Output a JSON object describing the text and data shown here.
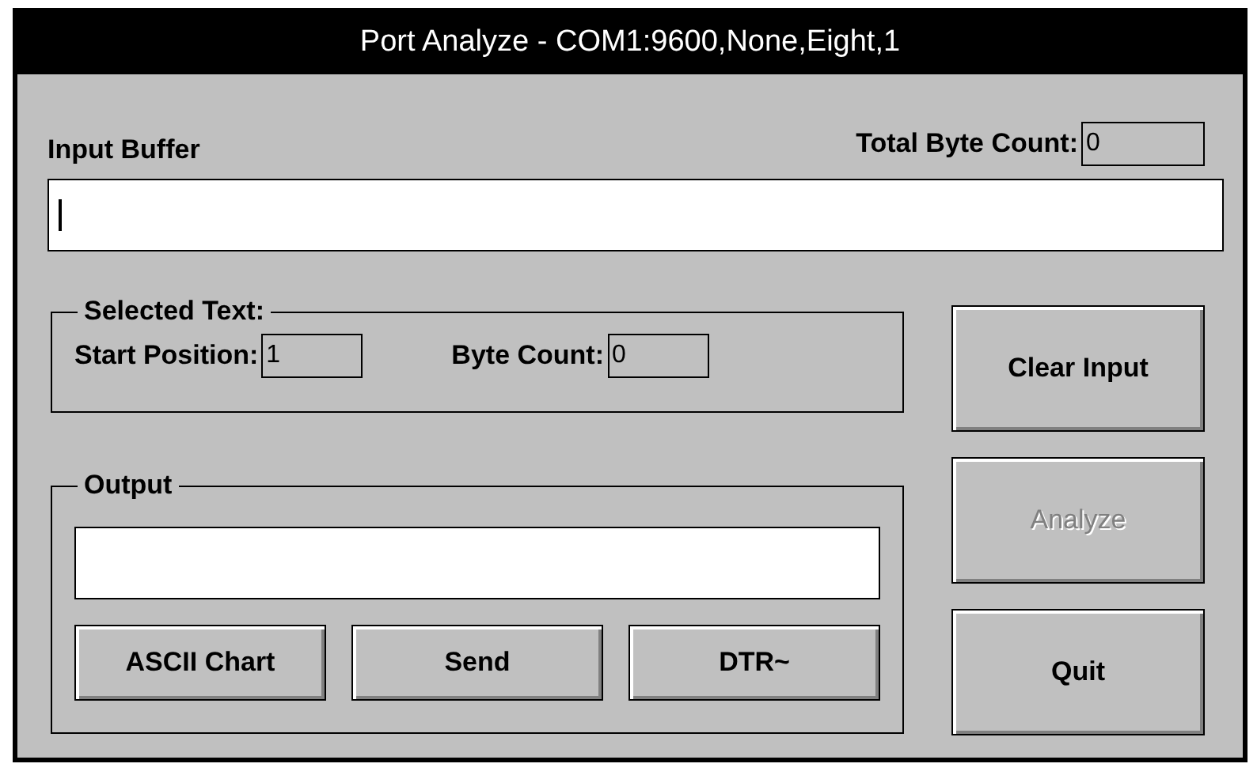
{
  "window": {
    "title": "Port Analyze - COM1:9600,None,Eight,1"
  },
  "input_buffer": {
    "label": "Input Buffer",
    "focused": true
  },
  "total_byte_count": {
    "label": "Total Byte Count:",
    "value": "0"
  },
  "selected_text": {
    "label": "Selected Text:",
    "fields": [
      {
        "label": "Start Position:",
        "value": "1"
      },
      {
        "label": "Byte Count:",
        "value": "0"
      }
    ]
  },
  "output": {
    "label": "Output",
    "buttons": [
      {
        "label": "ASCII Chart",
        "disabled": false
      },
      {
        "label": "Send",
        "disabled": false
      },
      {
        "label": "DTR~",
        "disabled": false
      }
    ]
  },
  "side_buttons": [
    {
      "label": "Clear Input",
      "disabled": false
    },
    {
      "label": "Analyze",
      "disabled": true
    },
    {
      "label": "Quit",
      "disabled": false
    }
  ]
}
